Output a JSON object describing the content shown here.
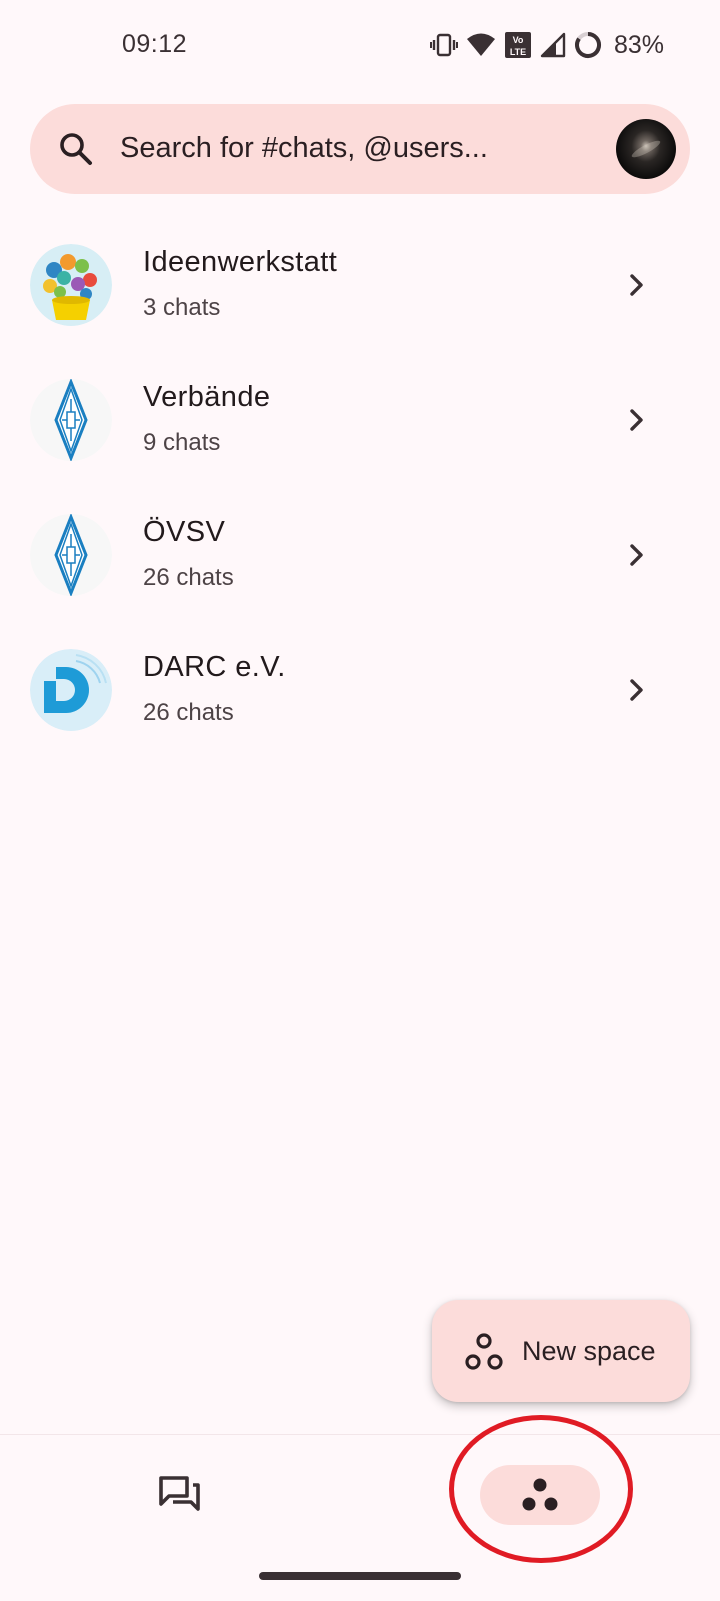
{
  "status_bar": {
    "time": "09:12",
    "battery": "83%",
    "icons": [
      "vibrate-icon",
      "wifi-icon",
      "volte-icon",
      "signal-icon",
      "battery-icon"
    ]
  },
  "search": {
    "placeholder": "Search for #chats, @users..."
  },
  "spaces": [
    {
      "name": "Ideenwerkstatt",
      "subtitle": "3 chats",
      "avatar": "lightbulb-collage-avatar"
    },
    {
      "name": "Verbände",
      "subtitle": "9 chats",
      "avatar": "diamond-emblem-avatar"
    },
    {
      "name": "ÖVSV",
      "subtitle": "26 chats",
      "avatar": "diamond-emblem-avatar"
    },
    {
      "name": "DARC e.V.",
      "subtitle": "26 chats",
      "avatar": "darc-logo-avatar"
    }
  ],
  "fab": {
    "label": "New space"
  },
  "bottom_nav": {
    "items": [
      {
        "icon": "chats-icon",
        "selected": false
      },
      {
        "icon": "spaces-icon",
        "selected": true
      }
    ]
  },
  "colors": {
    "background": "#fff8fa",
    "surface_pink": "#fcdcda",
    "highlight_ring": "#e01b24",
    "text_primary": "#221a1c"
  }
}
